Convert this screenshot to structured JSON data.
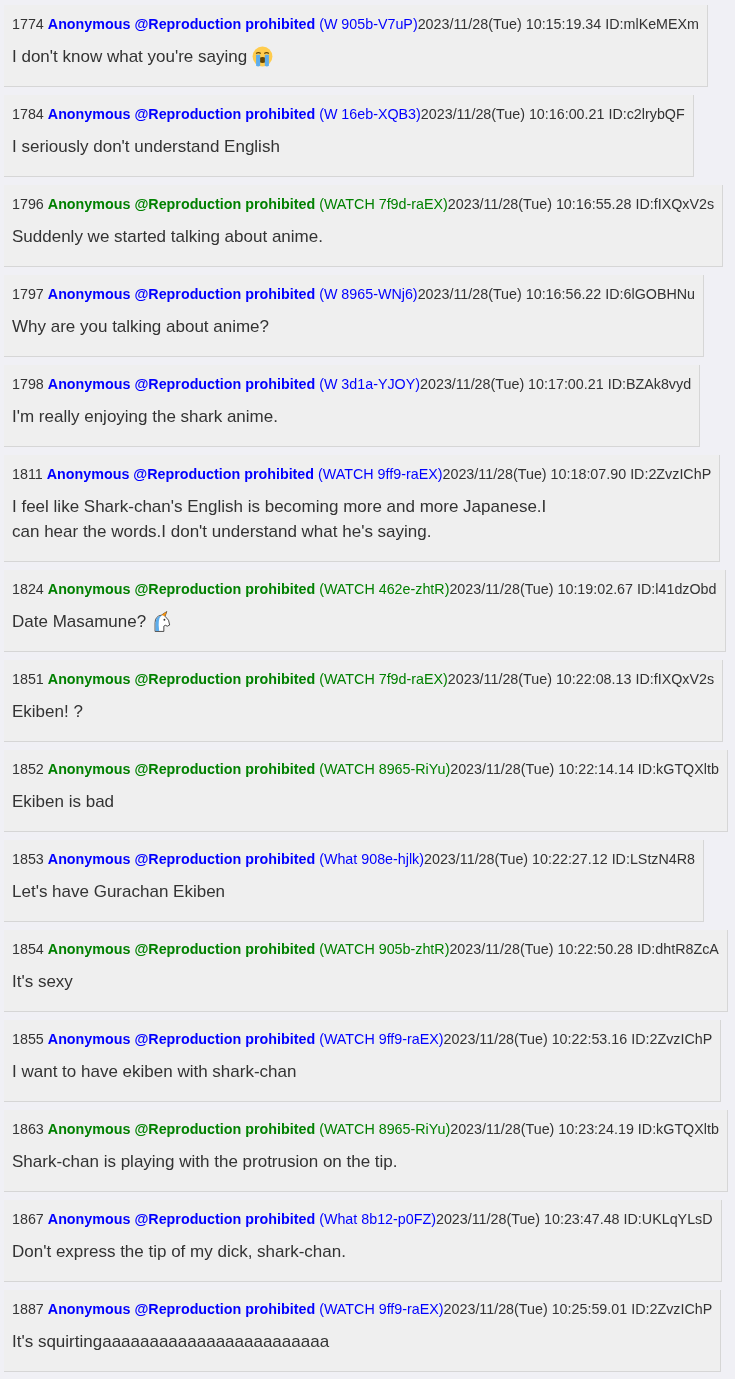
{
  "posts": [
    {
      "number": "1774",
      "name": "Anonymous @Reproduction prohibited",
      "color": "#0000ff",
      "trip": "(W 905b-V7uP)",
      "date": "2023/11/28(Tue) 10:15:19.34",
      "id": "ID:mlKeMEXm",
      "body": "I don't know what you're saying",
      "emoji": {
        "kind": "crying-face"
      }
    },
    {
      "number": "1784",
      "name": "Anonymous @Reproduction prohibited",
      "color": "#0000ff",
      "trip": "(W 16eb-XQB3)",
      "date": "2023/11/28(Tue) 10:16:00.21",
      "id": "ID:c2lrybQF",
      "body": "I seriously don't understand English"
    },
    {
      "number": "1796",
      "name": "Anonymous @Reproduction prohibited",
      "color": "#008000",
      "trip": "(WATCH 7f9d-raEX)",
      "date": "2023/11/28(Tue) 10:16:55.28",
      "id": "ID:fIXQxV2s",
      "body": "Suddenly we started talking about anime."
    },
    {
      "number": "1797",
      "name": "Anonymous @Reproduction prohibited",
      "color": "#0000ff",
      "trip": "(W 8965-WNj6)",
      "date": "2023/11/28(Tue) 10:16:56.22",
      "id": "ID:6lGOBHNu",
      "body": "Why are you talking about anime?"
    },
    {
      "number": "1798",
      "name": "Anonymous @Reproduction prohibited",
      "color": "#0000ff",
      "trip": "(W 3d1a-YJOY)",
      "date": "2023/11/28(Tue) 10:17:00.21",
      "id": "ID:BZAk8vyd",
      "body": "I'm really enjoying the shark anime."
    },
    {
      "number": "1811",
      "name": "Anonymous @Reproduction prohibited",
      "color": "#0000ff",
      "trip": "(WATCH 9ff9-raEX)",
      "date": "2023/11/28(Tue) 10:18:07.90",
      "id": "ID:2ZvzIChP",
      "body": "I feel like Shark-chan's English is becoming more and more Japanese.I\ncan hear the words.I don't understand what he's saying."
    },
    {
      "number": "1824",
      "name": "Anonymous @Reproduction prohibited",
      "color": "#008000",
      "trip": "(WATCH 462e-zhtR)",
      "date": "2023/11/28(Tue) 10:19:02.67",
      "id": "ID:l41dzObd",
      "body": "Date Masamune?",
      "emoji": {
        "kind": "unicorn"
      }
    },
    {
      "number": "1851",
      "name": "Anonymous @Reproduction prohibited",
      "color": "#008000",
      "trip": "(WATCH 7f9d-raEX)",
      "date": "2023/11/28(Tue) 10:22:08.13",
      "id": "ID:fIXQxV2s",
      "body": "Ekiben! ?"
    },
    {
      "number": "1852",
      "name": "Anonymous @Reproduction prohibited",
      "color": "#008000",
      "trip": "(WATCH 8965-RiYu)",
      "date": "2023/11/28(Tue) 10:22:14.14",
      "id": "ID:kGTQXltb",
      "body": "Ekiben is bad"
    },
    {
      "number": "1853",
      "name": "Anonymous @Reproduction prohibited",
      "color": "#0000ff",
      "trip": "(What 908e-hjlk)",
      "date": "2023/11/28(Tue) 10:22:27.12",
      "id": "ID:LStzN4R8",
      "body": "Let's have Gurachan Ekiben"
    },
    {
      "number": "1854",
      "name": "Anonymous @Reproduction prohibited",
      "color": "#008000",
      "trip": "(WATCH 905b-zhtR)",
      "date": "2023/11/28(Tue) 10:22:50.28",
      "id": "ID:dhtR8ZcA",
      "body": "It's sexy"
    },
    {
      "number": "1855",
      "name": "Anonymous @Reproduction prohibited",
      "color": "#0000ff",
      "trip": "(WATCH 9ff9-raEX)",
      "date": "2023/11/28(Tue) 10:22:53.16",
      "id": "ID:2ZvzIChP",
      "body": "I want to have ekiben with shark-chan"
    },
    {
      "number": "1863",
      "name": "Anonymous @Reproduction prohibited",
      "color": "#008000",
      "trip": "(WATCH 8965-RiYu)",
      "date": "2023/11/28(Tue) 10:23:24.19",
      "id": "ID:kGTQXltb",
      "body": "Shark-chan is playing with the protrusion on the tip."
    },
    {
      "number": "1867",
      "name": "Anonymous @Reproduction prohibited",
      "color": "#0000ff",
      "trip": "(What 8b12-p0FZ)",
      "date": "2023/11/28(Tue) 10:23:47.48",
      "id": "ID:UKLqYLsD",
      "body": "Don't express the tip of my dick, shark-chan."
    },
    {
      "number": "1887",
      "name": "Anonymous @Reproduction prohibited",
      "color": "#0000ff",
      "trip": "(WATCH 9ff9-raEX)",
      "date": "2023/11/28(Tue) 10:25:59.01",
      "id": "ID:2ZvzIChP",
      "body": "It's squirtingaaaaaaaaaaaaaaaaaaaaaaaa"
    }
  ]
}
